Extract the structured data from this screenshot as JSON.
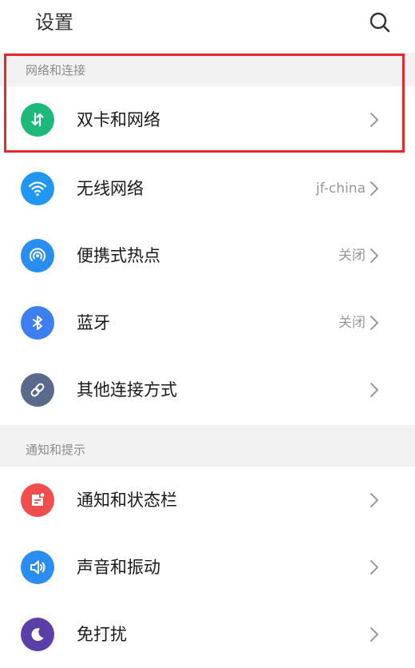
{
  "header": {
    "title": "设置",
    "search_icon": "search-icon"
  },
  "sections": [
    {
      "title": "网络和连接",
      "items": [
        {
          "label": "双卡和网络",
          "value": "",
          "icon": "dual-sim-icon",
          "color": "#1db97a"
        },
        {
          "label": "无线网络",
          "value": "jf-china",
          "icon": "wifi-icon",
          "color": "#2196f3"
        },
        {
          "label": "便携式热点",
          "value": "关闭",
          "icon": "hotspot-icon",
          "color": "#2a8ef0"
        },
        {
          "label": "蓝牙",
          "value": "关闭",
          "icon": "bluetooth-icon",
          "color": "#3d7ff0"
        },
        {
          "label": "其他连接方式",
          "value": "",
          "icon": "link-icon",
          "color": "#5a6a8c"
        }
      ]
    },
    {
      "title": "通知和提示",
      "items": [
        {
          "label": "通知和状态栏",
          "value": "",
          "icon": "notification-icon",
          "color": "#f04e4e"
        },
        {
          "label": "声音和振动",
          "value": "",
          "icon": "sound-icon",
          "color": "#2a8ef0"
        },
        {
          "label": "免打扰",
          "value": "",
          "icon": "moon-icon",
          "color": "#5b3fa8"
        }
      ]
    }
  ],
  "highlight_color": "#e8272c"
}
